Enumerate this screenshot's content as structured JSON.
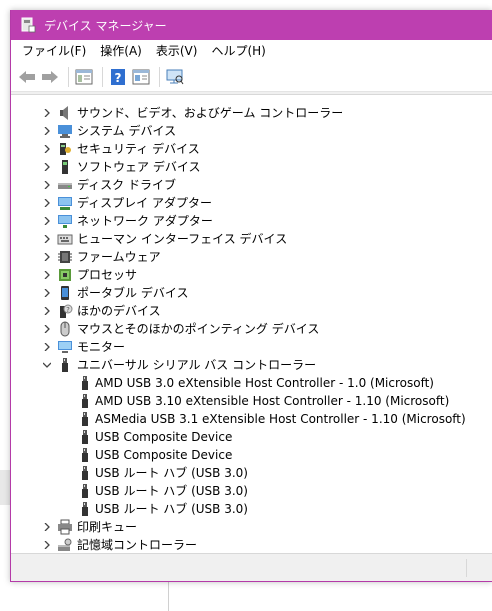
{
  "window": {
    "title": "デバイス マネージャー",
    "accent": "#bd3fb0"
  },
  "menu": {
    "file": "ファイル(F)",
    "action": "操作(A)",
    "view": "表示(V)",
    "help": "ヘルプ(H)"
  },
  "toolbar": {
    "buttons": [
      "back-arrow-icon",
      "forward-arrow-icon",
      "properties-grid-icon",
      "help-icon",
      "update-driver-icon",
      "monitor-scan-icon"
    ]
  },
  "tree": {
    "categories": [
      {
        "label": "サウンド、ビデオ、およびゲーム コントローラー",
        "icon": "speaker-icon"
      },
      {
        "label": "システム デバイス",
        "icon": "system-device-icon"
      },
      {
        "label": "セキュリティ デバイス",
        "icon": "security-key-icon"
      },
      {
        "label": "ソフトウェア デバイス",
        "icon": "software-device-icon"
      },
      {
        "label": "ディスク ドライブ",
        "icon": "disk-drive-icon"
      },
      {
        "label": "ディスプレイ アダプター",
        "icon": "display-adapter-icon"
      },
      {
        "label": "ネットワーク アダプター",
        "icon": "network-adapter-icon"
      },
      {
        "label": "ヒューマン インターフェイス デバイス",
        "icon": "hid-icon"
      },
      {
        "label": "ファームウェア",
        "icon": "firmware-chip-icon"
      },
      {
        "label": "プロセッサ",
        "icon": "processor-icon"
      },
      {
        "label": "ポータブル デバイス",
        "icon": "portable-device-icon"
      },
      {
        "label": "ほかのデバイス",
        "icon": "unknown-device-icon"
      },
      {
        "label": "マウスとそのほかのポインティング デバイス",
        "icon": "mouse-icon"
      },
      {
        "label": "モニター",
        "icon": "monitor-icon"
      },
      {
        "label": "ユニバーサル シリアル バス コントローラー",
        "icon": "usb-icon",
        "expanded": true
      }
    ],
    "usb_children": [
      "AMD USB 3.0 eXtensible Host Controller - 1.0 (Microsoft)",
      "AMD USB 3.10 eXtensible Host Controller - 1.10 (Microsoft)",
      "ASMedia USB 3.1 eXtensible Host Controller - 1.10 (Microsoft)",
      "USB Composite Device",
      "USB Composite Device",
      "USB ルート ハブ (USB 3.0)",
      "USB ルート ハブ (USB 3.0)",
      "USB ルート ハブ (USB 3.0)"
    ],
    "after": [
      {
        "label": "印刷キュー",
        "icon": "printer-icon"
      },
      {
        "label": "記憶域コントローラー",
        "icon": "storage-controller-icon"
      }
    ]
  }
}
